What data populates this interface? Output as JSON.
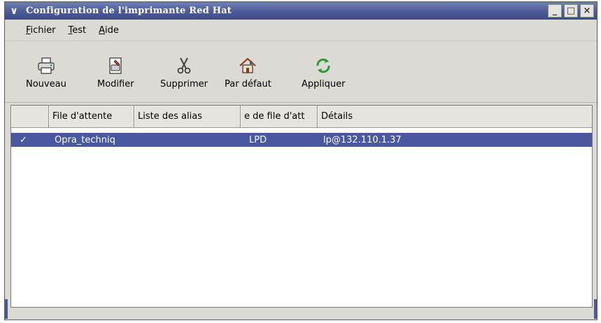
{
  "window": {
    "title": "Configuration de l'imprimante Red Hat",
    "menu_glyph": "∨",
    "minimize_glyph": "_",
    "maximize_glyph": "□",
    "close_glyph": "×"
  },
  "menubar": {
    "items": [
      {
        "underline": "F",
        "rest": "ichier"
      },
      {
        "underline": "T",
        "rest": "est"
      },
      {
        "underline": "A",
        "rest": "ide"
      }
    ]
  },
  "toolbar": {
    "new_label": "Nouveau",
    "edit_label": "Modifier",
    "delete_label": "Supprimer",
    "default_label": "Par défaut",
    "apply_label": "Appliquer"
  },
  "list": {
    "columns": [
      "",
      "File d'attente",
      "Liste des alias",
      "e de file d'att",
      "Détails"
    ],
    "rows": [
      {
        "default_mark": "✓",
        "queue": "Opra_techniq",
        "aliases": "",
        "type": "LPD",
        "details": "lp@132.110.1.37"
      }
    ]
  },
  "colors": {
    "titlebar": "#4c5b98",
    "selection": "#4a58a0",
    "window_bg": "#dcdad5"
  },
  "icons": {
    "new": "printer-icon",
    "edit": "edit-printer-icon",
    "delete": "scissors-icon",
    "default": "house-icon",
    "apply": "refresh-arrows-icon"
  }
}
